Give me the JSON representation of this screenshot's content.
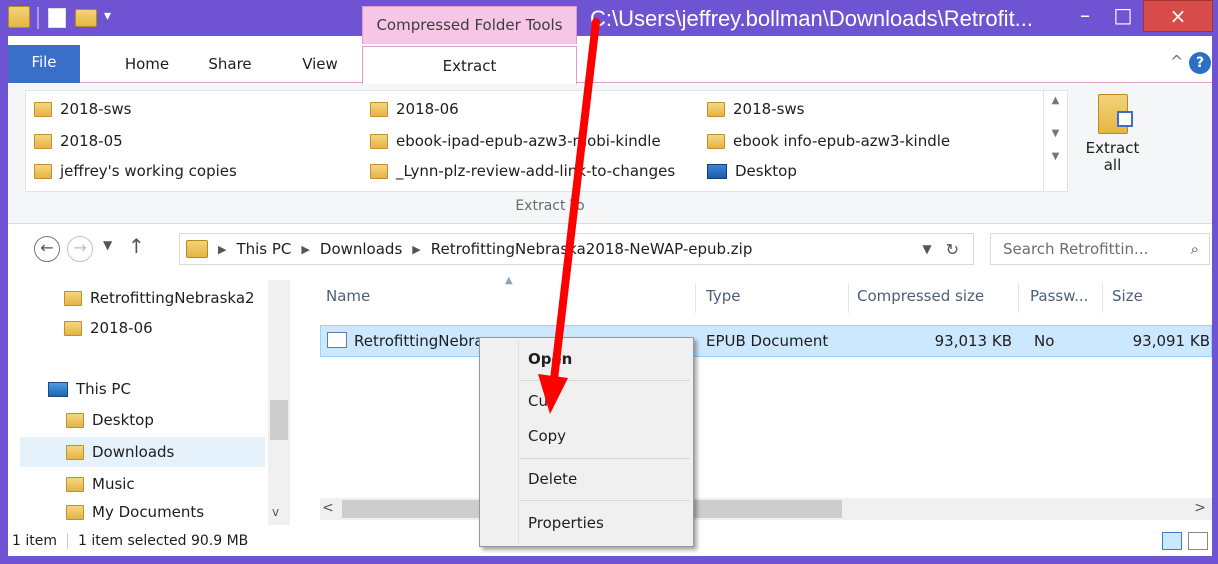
{
  "title_bar": {
    "context_tab_title": "Compressed Folder Tools",
    "window_title": "C:\\Users\\jeffrey.bollman\\Downloads\\Retrofit...",
    "minimize_glyph": "–",
    "maximize_glyph": "□",
    "close_glyph": "×"
  },
  "ribbon_tabs": [
    {
      "label": "File"
    },
    {
      "label": "Home"
    },
    {
      "label": "Share"
    },
    {
      "label": "View"
    },
    {
      "label": "Extract"
    }
  ],
  "ribbon_right": {
    "collapse_glyph": "^",
    "help_glyph": "?"
  },
  "extract_to": {
    "destinations": [
      {
        "label": "2018-sws",
        "icon": "folder-icon"
      },
      {
        "label": "2018-05",
        "icon": "folder-icon"
      },
      {
        "label": "jeffrey's working copies",
        "icon": "folder-icon"
      },
      {
        "label": "2018-06",
        "icon": "folder-icon"
      },
      {
        "label": "ebook-ipad-epub-azw3-mobi-kindle",
        "icon": "folder-icon"
      },
      {
        "label": "_Lynn-plz-review-add-link-to-changes",
        "icon": "folder-icon"
      },
      {
        "label": "2018-sws",
        "icon": "folder-icon"
      },
      {
        "label": "ebook info-epub-azw3-kindle",
        "icon": "folder-icon"
      },
      {
        "label": "Desktop",
        "icon": "desktop-icon"
      }
    ],
    "group_label": "Extract To",
    "extract_all_label_1": "Extract",
    "extract_all_label_2": "all"
  },
  "address_bar": {
    "segments": [
      "This PC",
      "Downloads",
      "RetrofittingNebraska2018-NeWAP-epub.zip"
    ],
    "search_placeholder": "Search Retrofittin..."
  },
  "nav_pane": {
    "items": [
      {
        "label": "RetrofittingNebraska2",
        "icon": "folder-icon"
      },
      {
        "label": "2018-06",
        "icon": "folder-icon"
      },
      {
        "label": "This PC",
        "icon": "computer-icon"
      },
      {
        "label": "Desktop",
        "icon": "desktop-folder-icon"
      },
      {
        "label": "Downloads",
        "icon": "downloads-folder-icon"
      },
      {
        "label": "Music",
        "icon": "music-folder-icon"
      },
      {
        "label": "My Documents",
        "icon": "documents-folder-icon"
      }
    ]
  },
  "file_list": {
    "columns": [
      "Name",
      "Type",
      "Compressed size",
      "Passw...",
      "Size"
    ],
    "rows": [
      {
        "name": "RetrofittingNebraska2018-NeWAP-epub",
        "type": "EPUB Document",
        "compressed_size": "93,013 KB",
        "password": "No",
        "size": "93,091 KB"
      }
    ]
  },
  "status_bar": {
    "item_count": "1 item",
    "selection": "1 item selected  90.9 MB"
  },
  "context_menu": {
    "items": [
      "Open",
      "Cut",
      "Copy",
      "Delete",
      "Properties"
    ]
  },
  "annotation": {
    "arrow_color": "#ff0000"
  },
  "colors": {
    "window_frame": "#6e54d3",
    "file_tab": "#3a6fc9",
    "context_tab": "#f6c6e6",
    "selection": "#cce8ff"
  }
}
